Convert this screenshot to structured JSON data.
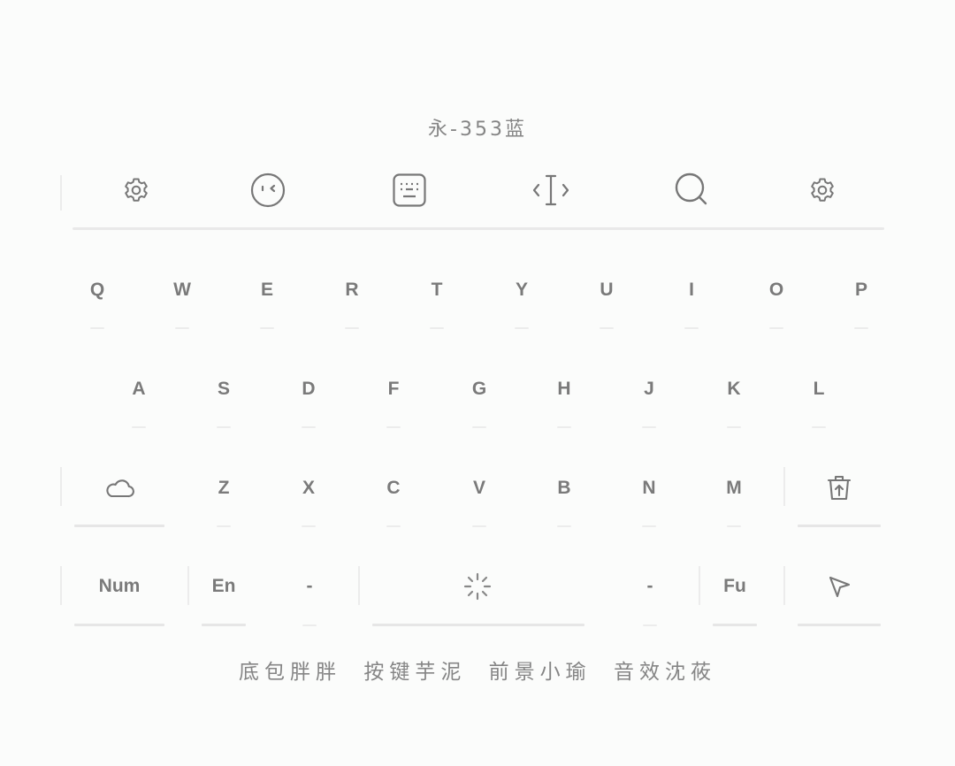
{
  "title": "永-353蓝",
  "toolbar": {
    "items": [
      {
        "icon": "settings-icon"
      },
      {
        "icon": "emoji-icon"
      },
      {
        "icon": "keyboard-icon"
      },
      {
        "icon": "cursor-move-icon"
      },
      {
        "icon": "search-icon"
      },
      {
        "icon": "settings-icon"
      }
    ]
  },
  "keyboard": {
    "row1": [
      "Q",
      "W",
      "E",
      "R",
      "T",
      "Y",
      "U",
      "I",
      "O",
      "P"
    ],
    "row2": [
      "A",
      "S",
      "D",
      "F",
      "G",
      "H",
      "J",
      "K",
      "L"
    ],
    "row3": [
      "Z",
      "X",
      "C",
      "V",
      "B",
      "N",
      "M"
    ],
    "row3_left_icon": "cloud-icon",
    "row3_right_icon": "delete-icon",
    "bottom": {
      "num": "Num",
      "en": "En",
      "dash_left": "-",
      "space_icon": "loading-spinner-icon",
      "dash_right": "-",
      "fu": "Fu",
      "enter_icon": "send-arrow-icon"
    }
  },
  "footer": {
    "items": [
      "底包胖胖",
      "按键芋泥",
      "前景小瑜",
      "音效沈莜"
    ]
  },
  "colors": {
    "background": "#fbfcfb",
    "text": "#7a7a7a",
    "separator": "#e9e9e9"
  }
}
